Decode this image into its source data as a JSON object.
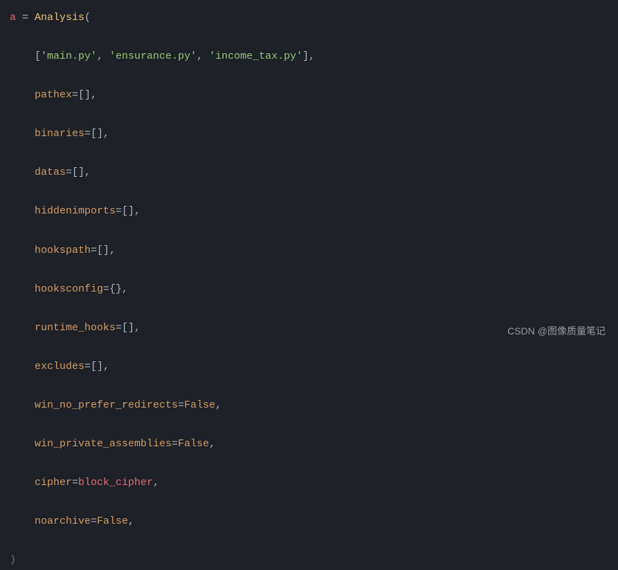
{
  "code": {
    "line1_var": "a",
    "line1_op": " = ",
    "line1_func": "Analysis",
    "line1_open": "(",
    "line2_arr_open": "[",
    "line2_str1": "'main.py'",
    "line2_c1": ", ",
    "line2_str2": "'ensurance.py'",
    "line2_c2": ", ",
    "line2_str3": "'income_tax.py'",
    "line2_arr_close": "]",
    "line2_comma": ",",
    "line3_param": "pathex",
    "line3_eq": "=[],",
    "line4_param": "binaries",
    "line4_eq": "=[],",
    "line5_param": "datas",
    "line5_eq": "=[],",
    "line6_param": "hiddenimports",
    "line6_eq": "=[],",
    "line7_param": "hookspath",
    "line7_eq": "=[],",
    "line8_param": "hooksconfig",
    "line8_eq": "={},",
    "line9_param": "runtime_hooks",
    "line9_eq": "=[],",
    "line10_param": "excludes",
    "line10_eq": "=[],",
    "line11_param": "win_no_prefer_redirects",
    "line11_eq": "=",
    "line11_val": "False",
    "line11_c": ",",
    "line12_param": "win_private_assemblies",
    "line12_eq": "=",
    "line12_val": "False",
    "line12_c": ",",
    "line13_param": "cipher",
    "line13_eq": "=",
    "line13_val": "block_cipher",
    "line13_c": ",",
    "line14_param": "noarchive",
    "line14_eq": "=",
    "line14_val": "False",
    "line14_c": ",",
    "line15_close": ")"
  },
  "watermark": "CSDN @图像质量笔记"
}
